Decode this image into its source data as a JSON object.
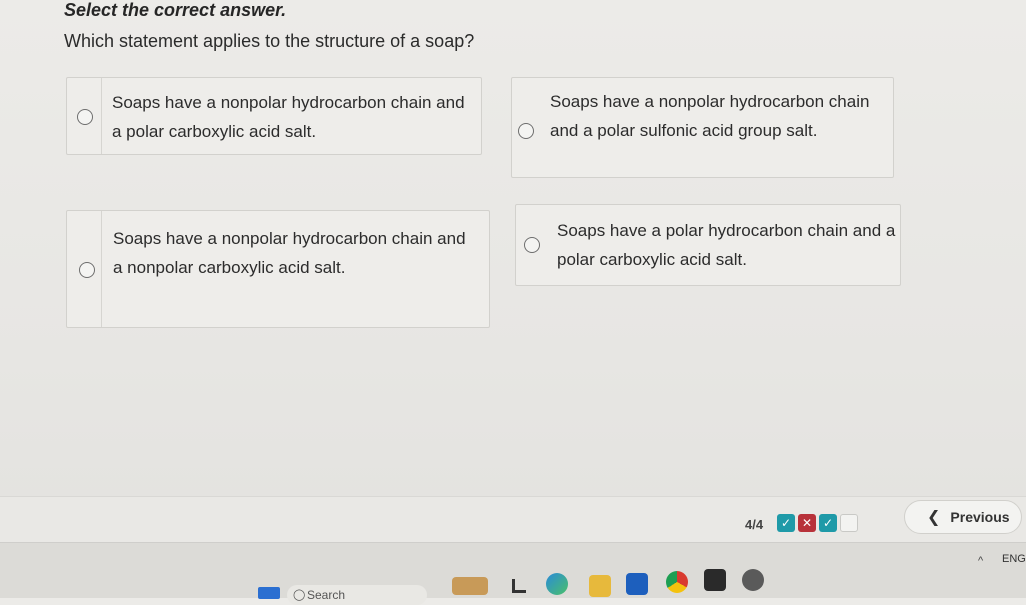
{
  "instruction": "Select the correct answer.",
  "question": "Which statement applies to the structure of a soap?",
  "options": [
    {
      "text": "Soaps have a nonpolar hydrocarbon chain and a polar carboxylic acid salt."
    },
    {
      "text": "Soaps have a nonpolar hydrocarbon chain and a polar sulfonic acid group salt."
    },
    {
      "text": "Soaps have a nonpolar hydrocarbon chain and a nonpolar carboxylic acid salt."
    },
    {
      "text": "Soaps have a polar hydrocarbon chain and a polar carboxylic acid salt."
    }
  ],
  "footer": {
    "progress": "4/4",
    "progress_marks": [
      "✓",
      "✕",
      "✓",
      ""
    ],
    "previous_label": "Previous"
  },
  "taskbar": {
    "search_label": "Search",
    "lang": "ENG",
    "colors": {
      "ok": "#1f9aa8",
      "bad": "#b8323a"
    }
  }
}
